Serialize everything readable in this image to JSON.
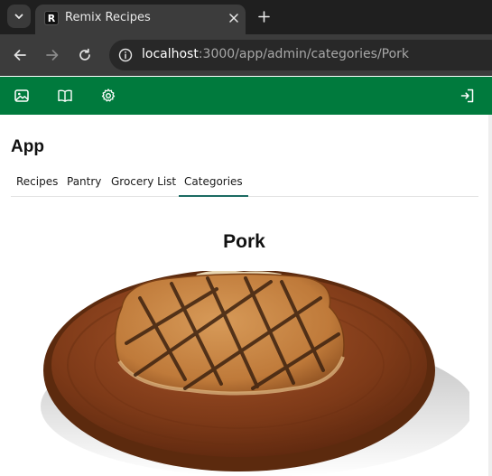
{
  "browser": {
    "tab_title": "Remix Recipes",
    "favicon_letter": "R",
    "url_host": "localhost",
    "url_path": ":3000/app/admin/categories/Pork"
  },
  "header": {
    "background_color": "#007a3d",
    "icons": [
      "image-icon",
      "book-icon",
      "gear-icon",
      "logout-icon"
    ]
  },
  "app": {
    "title": "App",
    "nav_tabs": [
      {
        "label": "Recipes"
      },
      {
        "label": "Pantry"
      },
      {
        "label": "Grocery List"
      },
      {
        "label": "Categories",
        "active": true
      }
    ],
    "active_tab_color": "#1c6b63"
  },
  "category": {
    "name": "Pork"
  }
}
